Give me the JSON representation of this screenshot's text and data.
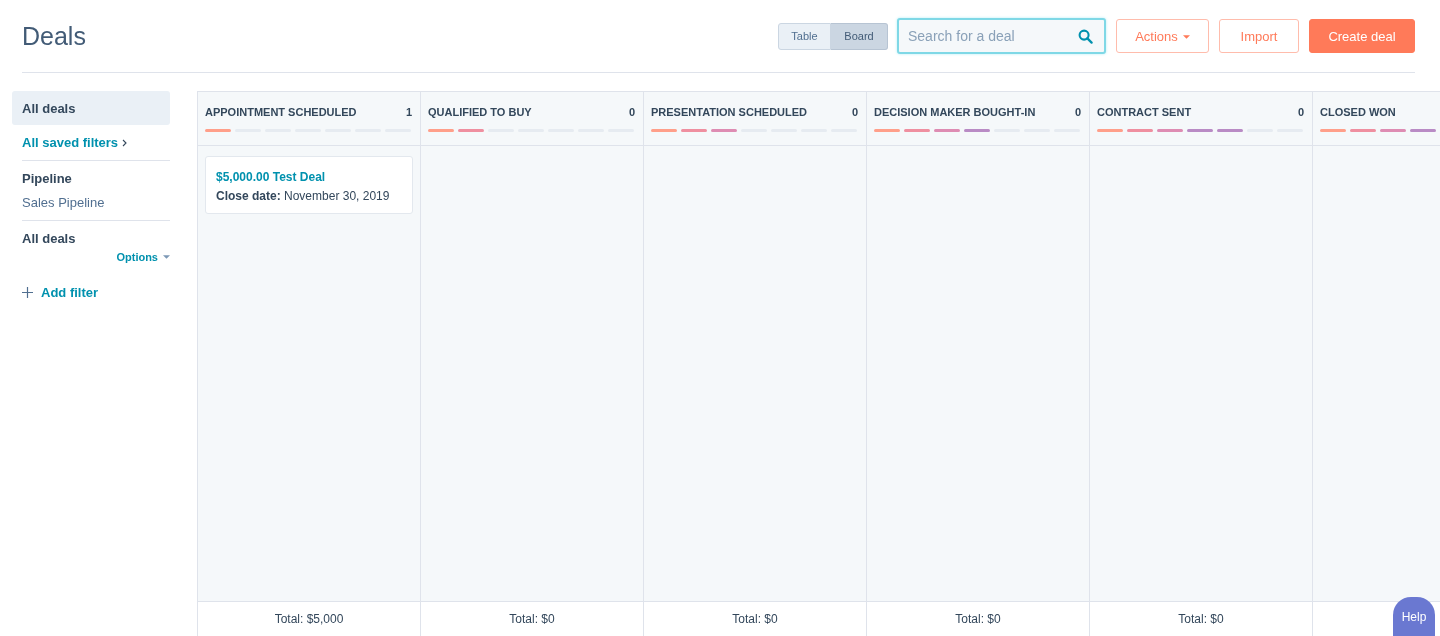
{
  "header": {
    "title": "Deals"
  },
  "view_toggle": [
    {
      "label": "Table",
      "selected": false
    },
    {
      "label": "Board",
      "selected": true
    }
  ],
  "search": {
    "placeholder": "Search for a deal"
  },
  "actions": [
    {
      "label": "Actions",
      "kind": "dropdown"
    },
    {
      "label": "Import",
      "kind": "secondary"
    },
    {
      "label": "Create deal",
      "kind": "primary"
    }
  ],
  "sidebar": {
    "views": [
      {
        "label": "All deals",
        "selected": true
      }
    ],
    "saved_filters_link": "All saved filters",
    "pipeline_label": "Pipeline",
    "pipeline_value": "Sales Pipeline",
    "filter_title": "All deals",
    "options_label": "Options",
    "add_filter": "Add filter"
  },
  "board": {
    "columns": [
      {
        "title": "APPOINTMENT SCHEDULED",
        "count": "1",
        "stages": [
          {
            "done": true,
            "color": "#ff9f8a"
          },
          {
            "done": false
          },
          {
            "done": false
          },
          {
            "done": false
          },
          {
            "done": false
          },
          {
            "done": false
          },
          {
            "done": false
          }
        ],
        "cards": [
          {
            "title": "$5,000.00 Test Deal",
            "detail": "**Close date:** November 30, 2019"
          }
        ],
        "total": "Total: $5,000"
      },
      {
        "title": "QUALIFIED TO BUY",
        "count": "0",
        "stages": [
          {
            "done": true,
            "color": "#ff9f8a"
          },
          {
            "done": true,
            "color": "#ef8fa0"
          },
          {
            "done": false
          },
          {
            "done": false
          },
          {
            "done": false
          },
          {
            "done": false
          },
          {
            "done": false
          }
        ],
        "total": "Total: $0"
      },
      {
        "title": "PRESENTATION SCHEDULED",
        "count": "0",
        "stages": [
          {
            "done": true,
            "color": "#ff9f8a"
          },
          {
            "done": true,
            "color": "#ef8fa0"
          },
          {
            "done": true,
            "color": "#de8cb3"
          },
          {
            "done": false
          },
          {
            "done": false
          },
          {
            "done": false
          },
          {
            "done": false
          }
        ],
        "total": "Total: $0"
      },
      {
        "title": "DECISION MAKER BOUGHT-IN",
        "count": "0",
        "stages": [
          {
            "done": true,
            "color": "#ff9f8a"
          },
          {
            "done": true,
            "color": "#ef8fa0"
          },
          {
            "done": true,
            "color": "#de8cb3"
          },
          {
            "done": true,
            "color": "#b98bc5"
          },
          {
            "done": false
          },
          {
            "done": false
          },
          {
            "done": false
          }
        ],
        "total": "Total: $0"
      },
      {
        "title": "CONTRACT SENT",
        "count": "0",
        "stages": [
          {
            "done": true,
            "color": "#ff9f8a"
          },
          {
            "done": true,
            "color": "#ef8fa0"
          },
          {
            "done": true,
            "color": "#de8cb3"
          },
          {
            "done": true,
            "color": "#b98bc5"
          },
          {
            "done": true,
            "color": "#b98bc5"
          },
          {
            "done": false
          },
          {
            "done": false
          }
        ],
        "total": "Total: $0"
      },
      {
        "title": "CLOSED WON",
        "stages": [
          {
            "done": true,
            "color": "#ff9f8a"
          },
          {
            "done": true,
            "color": "#ef8fa0"
          },
          {
            "done": true,
            "color": "#de8cb3"
          },
          {
            "done": true,
            "color": "#b98bc5"
          }
        ]
      }
    ]
  },
  "help_button": "Help"
}
